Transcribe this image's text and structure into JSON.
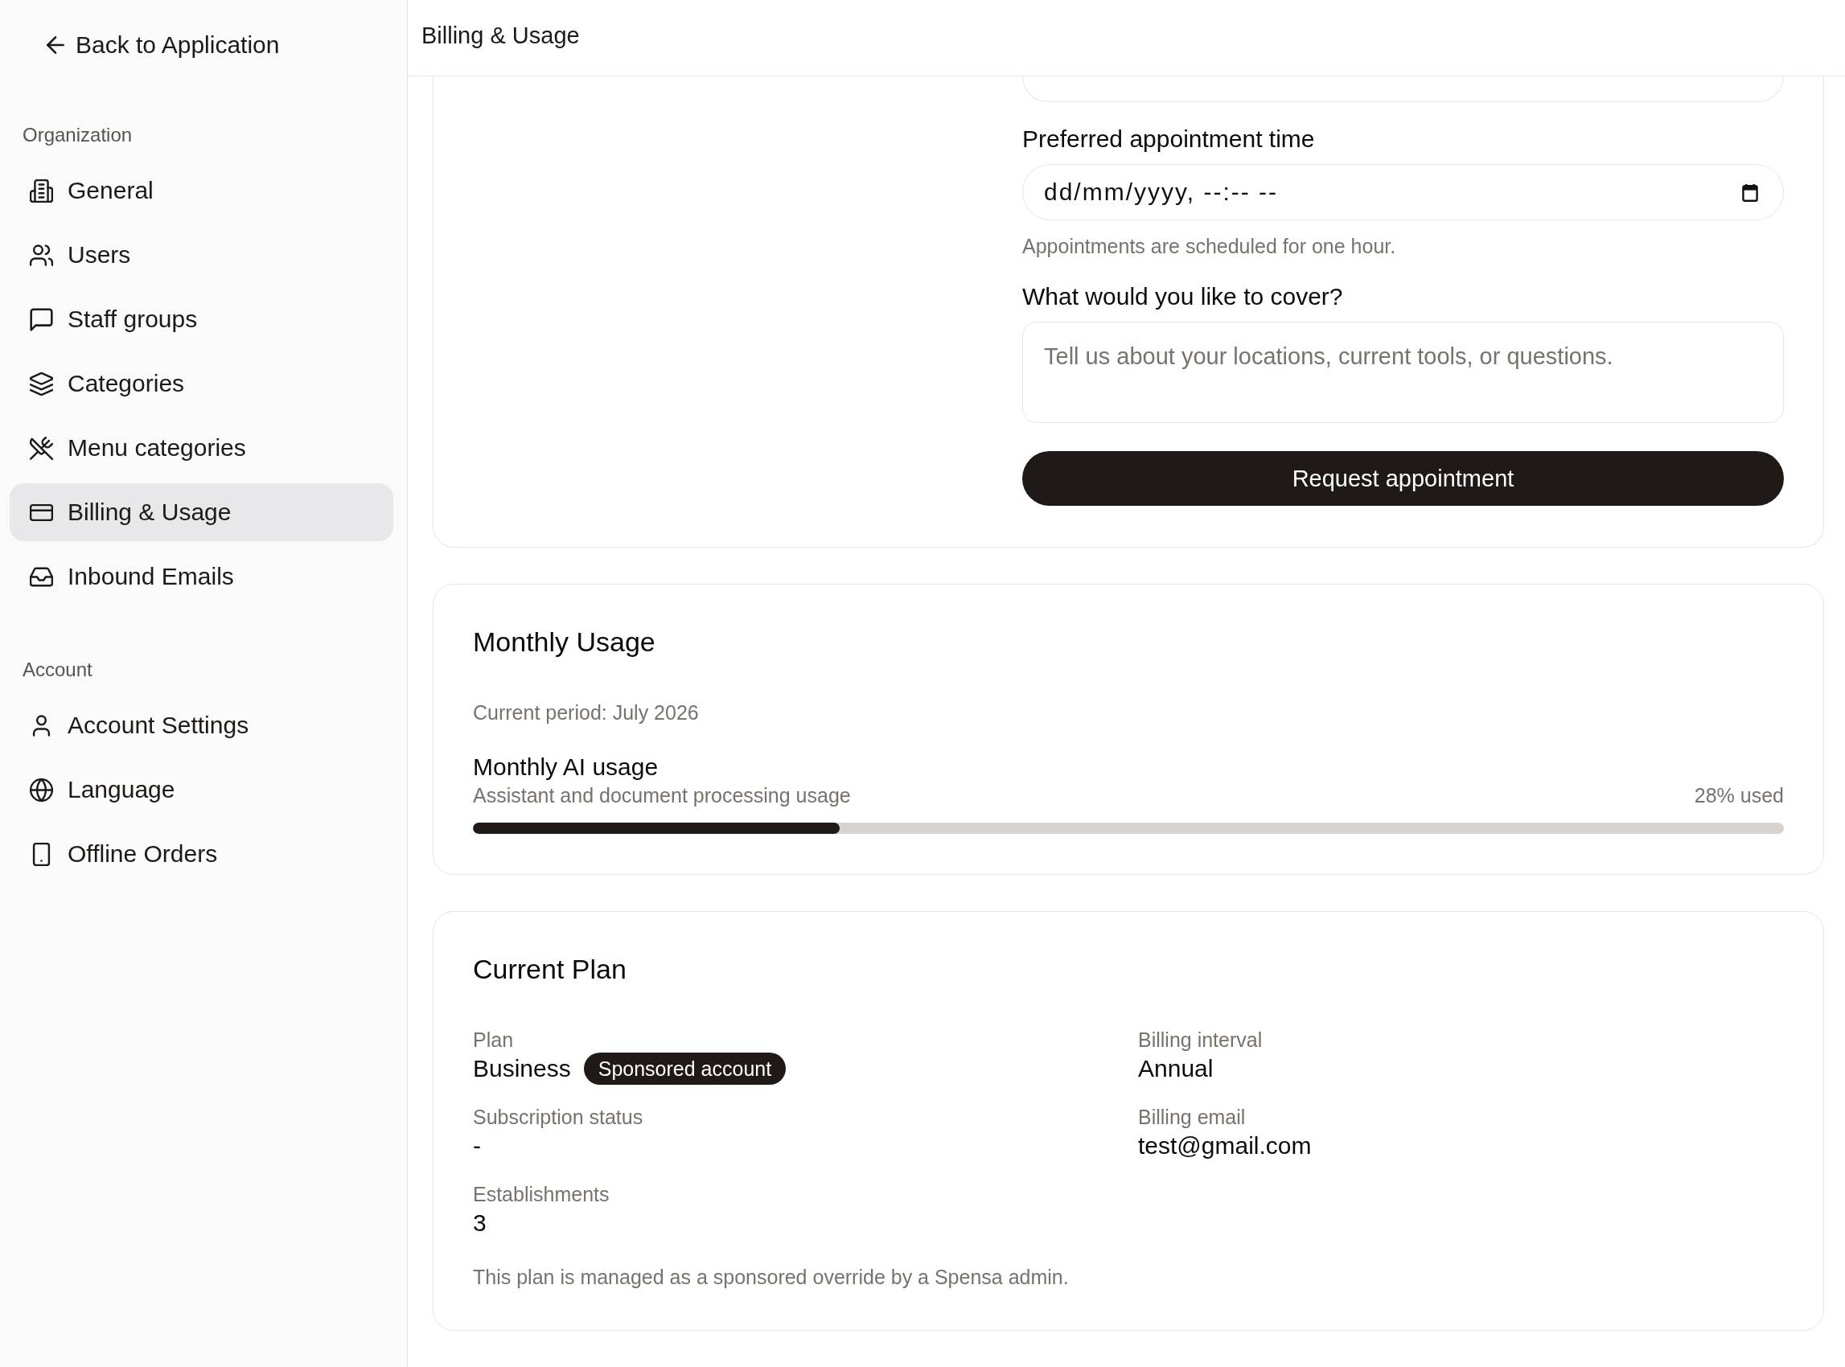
{
  "sidebar": {
    "back_link": "Back to Application",
    "sections": [
      {
        "heading": "Organization",
        "items": [
          {
            "label": "General",
            "selected": false
          },
          {
            "label": "Users",
            "selected": false
          },
          {
            "label": "Staff groups",
            "selected": false
          },
          {
            "label": "Categories",
            "selected": false
          },
          {
            "label": "Menu categories",
            "selected": false
          },
          {
            "label": "Billing & Usage",
            "selected": true
          },
          {
            "label": "Inbound Emails",
            "selected": false
          }
        ]
      },
      {
        "heading": "Account",
        "items": [
          {
            "label": "Account Settings",
            "selected": false
          },
          {
            "label": "Language",
            "selected": false
          },
          {
            "label": "Offline Orders",
            "selected": false
          }
        ]
      }
    ]
  },
  "header": {
    "title": "Billing & Usage"
  },
  "appointment_form": {
    "fields": [
      {
        "kind": "cut_off"
      },
      {
        "kind": "datetime",
        "label": "Preferred appointment time",
        "placeholder": "dd/mm/yyyy, --:-- --",
        "hint": "Appointments are scheduled for one hour."
      },
      {
        "kind": "textarea",
        "label": "What would you like to cover?",
        "placeholder": "Tell us about your locations, current tools, or questions."
      }
    ],
    "submit_button": "Request appointment"
  },
  "usage": {
    "title": "Monthly Usage",
    "period": "Current period: July 2026",
    "meters": [
      {
        "name": "Monthly AI usage",
        "description": "Assistant and document processing usage",
        "reading": "28% used",
        "level": 0.28
      }
    ]
  },
  "plan": {
    "title": "Current Plan",
    "fields": [
      {
        "label": "Plan",
        "value": "Business",
        "badge": "Sponsored account"
      },
      {
        "label": "Billing interval",
        "value": "Annual"
      },
      {
        "label": "Subscription status",
        "value": "-"
      },
      {
        "label": "Billing email",
        "value": "test@gmail.com"
      },
      {
        "label": "Establishments",
        "value": "3"
      }
    ],
    "note": "This plan is managed as a sponsored override by a Spensa admin."
  }
}
